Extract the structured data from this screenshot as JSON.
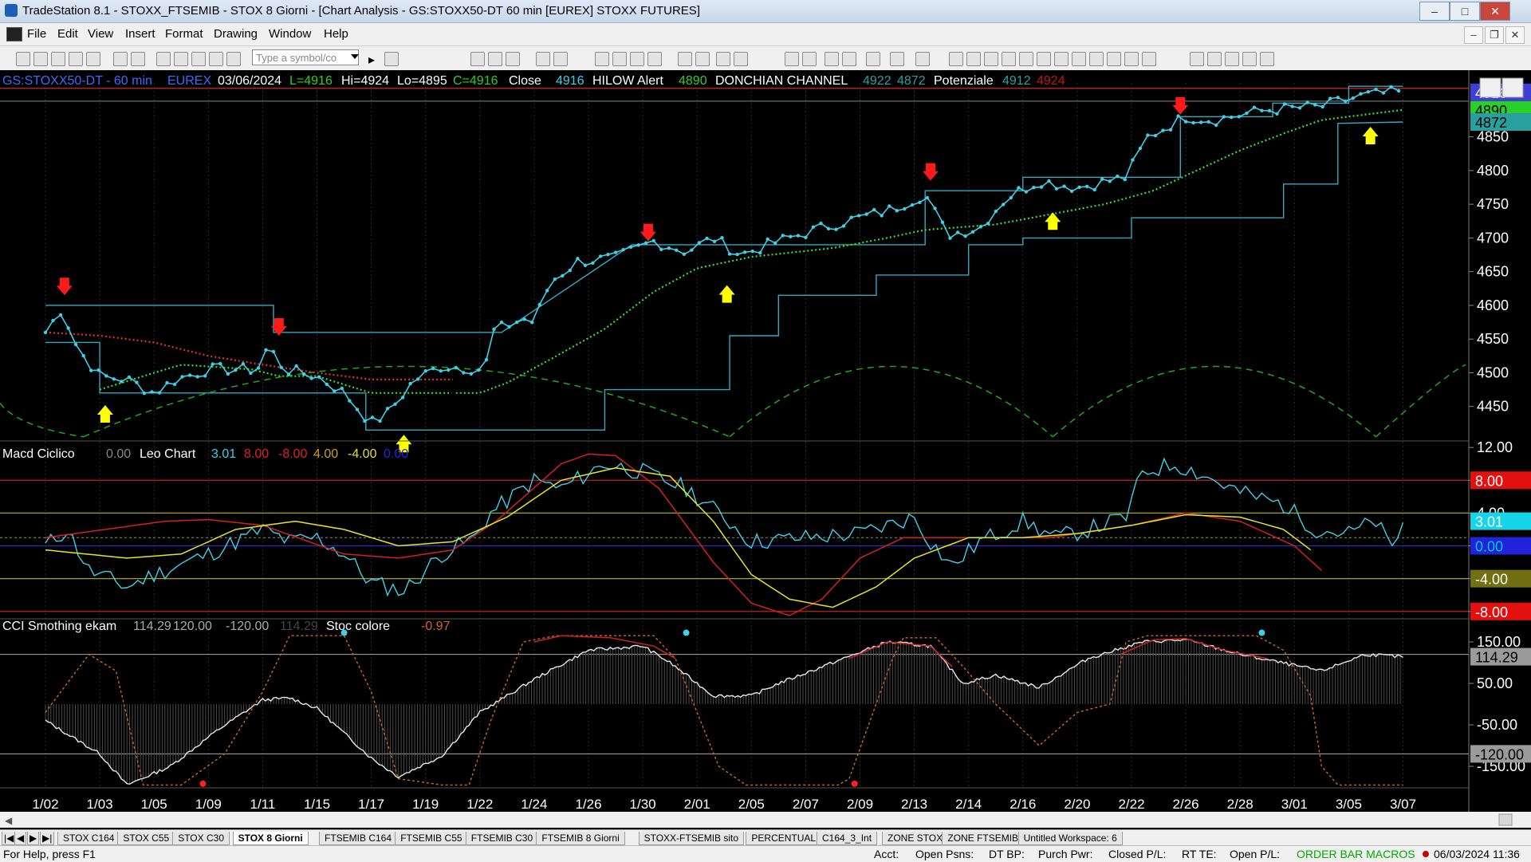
{
  "window": {
    "title": "TradeStation 8.1 - STOXX_FTSEMIB - STOX  8 Giorni - [Chart Analysis - GS:STOXX50-DT  60 min  [EUREX] STOXX FUTURES]"
  },
  "menu": [
    "File",
    "Edit",
    "View",
    "Insert",
    "Format",
    "Drawing",
    "Window",
    "Help"
  ],
  "toolbar": {
    "symbol_placeholder": "Type a symbol/co"
  },
  "colors": {
    "price": "#3fd0e8",
    "ma_up": "#31e031",
    "ma_down": "#e03030",
    "channel": "#34a8c0",
    "arrow_down": "#ff1a1a",
    "arrow_up": "#ffff00",
    "cycle": "#1fa51f"
  },
  "chart_data": [
    {
      "type": "line",
      "name": "price",
      "header": {
        "symbol": "GS:STOXX50-DT - 60 min",
        "exchange": "EUREX",
        "date": "03/06/2024",
        "last": "L=4916",
        "high": "Hi=4924",
        "low": "Lo=4895",
        "close": "C=4916",
        "close_label": "Close",
        "close_val": "4916",
        "hilow_label": "HILOW Alert",
        "hilow_val": "4890",
        "donchian_label": "DONCHIAN CHANNEL",
        "donchian_hi": "4922",
        "donchian_lo": "4872",
        "potenziale_label": "Potenziale",
        "potenziale_1": "4912",
        "potenziale_2": "4924"
      },
      "ylim": [
        4400,
        4930
      ],
      "yticks": [
        4450,
        4500,
        4550,
        4600,
        4650,
        4700,
        4750,
        4800,
        4850
      ],
      "last_price_labels": [
        "4916",
        "4890",
        "4872"
      ],
      "x_labels": [
        "1/02",
        "1/03",
        "1/05",
        "1/09",
        "1/11",
        "1/15",
        "1/17",
        "1/19",
        "1/22",
        "1/24",
        "1/26",
        "1/30",
        "2/01",
        "2/05",
        "2/07",
        "2/09",
        "2/13",
        "2/14",
        "2/16",
        "2/20",
        "2/22",
        "2/26",
        "2/28",
        "3/01",
        "3/05",
        "3/07"
      ],
      "close_anchors": [
        [
          0,
          4560
        ],
        [
          0.3,
          4595
        ],
        [
          0.6,
          4535
        ],
        [
          1.0,
          4495
        ],
        [
          1.5,
          4490
        ],
        [
          2.0,
          4470
        ],
        [
          2.4,
          4490
        ],
        [
          3.0,
          4505
        ],
        [
          3.9,
          4505
        ],
        [
          4.1,
          4540
        ],
        [
          4.4,
          4505
        ],
        [
          5.0,
          4495
        ],
        [
          5.5,
          4470
        ],
        [
          6.0,
          4425
        ],
        [
          6.3,
          4440
        ],
        [
          6.8,
          4490
        ],
        [
          7.3,
          4510
        ],
        [
          8.1,
          4505
        ],
        [
          8.2,
          4560
        ],
        [
          8.8,
          4580
        ],
        [
          9.0,
          4575
        ],
        [
          9.3,
          4635
        ],
        [
          9.8,
          4665
        ],
        [
          10.5,
          4670
        ],
        [
          11.2,
          4695
        ],
        [
          11.8,
          4680
        ],
        [
          12.3,
          4700
        ],
        [
          12.8,
          4675
        ],
        [
          13.5,
          4695
        ],
        [
          14.5,
          4720
        ],
        [
          15.5,
          4740
        ],
        [
          16.2,
          4765
        ],
        [
          16.6,
          4705
        ],
        [
          17.2,
          4715
        ],
        [
          17.7,
          4760
        ],
        [
          18.3,
          4785
        ],
        [
          19.0,
          4775
        ],
        [
          19.9,
          4790
        ],
        [
          20.3,
          4850
        ],
        [
          21.0,
          4880
        ],
        [
          21.5,
          4875
        ],
        [
          22.5,
          4890
        ],
        [
          23.5,
          4895
        ],
        [
          24.2,
          4910
        ],
        [
          24.7,
          4915
        ],
        [
          25.0,
          4916
        ]
      ],
      "ma_anchors": [
        [
          1.0,
          4475
        ],
        [
          1.8,
          4495
        ],
        [
          2.5,
          4512
        ],
        [
          3.8,
          4505
        ],
        [
          4.3,
          4495
        ],
        [
          5.0,
          4495
        ],
        [
          6.0,
          4470
        ],
        [
          7.0,
          4470
        ],
        [
          8.0,
          4470
        ],
        [
          8.5,
          4485
        ],
        [
          9.3,
          4520
        ],
        [
          10.3,
          4565
        ],
        [
          11.2,
          4620
        ],
        [
          12.0,
          4655
        ],
        [
          13.0,
          4672
        ],
        [
          14.5,
          4685
        ],
        [
          15.5,
          4700
        ],
        [
          16.2,
          4712
        ],
        [
          17.5,
          4720
        ],
        [
          18.5,
          4735
        ],
        [
          19.5,
          4750
        ],
        [
          20.4,
          4770
        ],
        [
          21.2,
          4800
        ],
        [
          22.0,
          4830
        ],
        [
          22.8,
          4855
        ],
        [
          23.5,
          4875
        ],
        [
          24.2,
          4882
        ],
        [
          25.0,
          4890
        ]
      ],
      "ma_split_day": 7.5,
      "dc_upper": [
        [
          0,
          4600
        ],
        [
          4.2,
          4600
        ],
        [
          4.2,
          4560
        ],
        [
          7.9,
          4560
        ],
        [
          7.9,
          4560
        ],
        [
          8.4,
          4560
        ],
        [
          10.8,
          4690
        ],
        [
          16.2,
          4690
        ],
        [
          16.2,
          4770
        ],
        [
          18.0,
          4770
        ],
        [
          18.0,
          4790
        ],
        [
          20.9,
          4790
        ],
        [
          20.9,
          4880
        ],
        [
          22.6,
          4880
        ],
        [
          22.6,
          4900
        ],
        [
          24.0,
          4900
        ],
        [
          24.0,
          4925
        ],
        [
          25.0,
          4925
        ]
      ],
      "dc_lower": [
        [
          0,
          4545
        ],
        [
          1.0,
          4545
        ],
        [
          1.0,
          4470
        ],
        [
          5.9,
          4470
        ],
        [
          5.9,
          4415
        ],
        [
          10.3,
          4415
        ],
        [
          10.3,
          4475
        ],
        [
          12.6,
          4475
        ],
        [
          12.6,
          4555
        ],
        [
          13.5,
          4555
        ],
        [
          13.5,
          4615
        ],
        [
          15.3,
          4615
        ],
        [
          15.3,
          4645
        ],
        [
          17.0,
          4645
        ],
        [
          17.0,
          4690
        ],
        [
          18.0,
          4690
        ],
        [
          18.0,
          4700
        ],
        [
          20.0,
          4700
        ],
        [
          20.0,
          4730
        ],
        [
          22.8,
          4730
        ],
        [
          22.8,
          4780
        ],
        [
          23.8,
          4780
        ],
        [
          23.8,
          4870
        ],
        [
          25.0,
          4872
        ]
      ],
      "down_arrows": [
        [
          0.35,
          4615
        ],
        [
          4.3,
          4555
        ],
        [
          11.1,
          4695
        ],
        [
          16.3,
          4785
        ],
        [
          20.9,
          4883
        ]
      ],
      "up_arrows": [
        [
          1.1,
          4452
        ],
        [
          6.6,
          4408
        ],
        [
          12.55,
          4630
        ],
        [
          18.55,
          4738
        ],
        [
          24.4,
          4865
        ]
      ],
      "cycle_lows_day": [
        0.7,
        12.6,
        18.55,
        24.5
      ],
      "cycle_top": 4515,
      "cycle_bottom": 4405
    },
    {
      "type": "line",
      "name": "macd",
      "header": {
        "title": "Macd Ciclico",
        "v0": "0.00",
        "title2": "Leo Chart",
        "v1": "3.01",
        "v2": "8.00",
        "v3": "-8.00",
        "v4": "4.00",
        "v5": "-4.00",
        "v6": "0.00"
      },
      "ylim": [
        -8.8,
        12.5
      ],
      "yticks": [
        -8,
        -4,
        0,
        4,
        8,
        12
      ],
      "tick_labels": [
        "-8.00",
        "-4.00",
        "0.00",
        "4.00",
        "8.00",
        "12.00"
      ],
      "last_labels": [
        "8.00",
        "3.01",
        "0.00",
        "-4.00",
        "-8.00"
      ],
      "osc_anchors": [
        [
          0,
          0
        ],
        [
          0.4,
          2
        ],
        [
          0.8,
          -3
        ],
        [
          1.5,
          -5
        ],
        [
          2.0,
          -3.5
        ],
        [
          3.0,
          -1
        ],
        [
          4.0,
          2
        ],
        [
          4.5,
          0.5
        ],
        [
          5.0,
          1.0
        ],
        [
          5.5,
          -1
        ],
        [
          6.0,
          -4.5
        ],
        [
          6.6,
          -5.5
        ],
        [
          7.3,
          -1
        ],
        [
          7.9,
          1
        ],
        [
          8.2,
          4
        ],
        [
          9.0,
          8
        ],
        [
          9.5,
          7
        ],
        [
          10.3,
          10
        ],
        [
          11.0,
          9
        ],
        [
          11.8,
          7
        ],
        [
          12.5,
          3.5
        ],
        [
          13.0,
          0.5
        ],
        [
          14.0,
          1.0
        ],
        [
          15.0,
          1.5
        ],
        [
          16.0,
          3.5
        ],
        [
          16.3,
          0.5
        ],
        [
          16.7,
          -2.5
        ],
        [
          17.2,
          0.5
        ],
        [
          18.0,
          3.0
        ],
        [
          18.6,
          1.0
        ],
        [
          19.2,
          2.0
        ],
        [
          19.9,
          3.5
        ],
        [
          20.2,
          9.0
        ],
        [
          20.8,
          10.0
        ],
        [
          21.2,
          9.0
        ],
        [
          22.0,
          6.5
        ],
        [
          22.8,
          5.0
        ],
        [
          23.4,
          2.0
        ],
        [
          24.0,
          1.5
        ],
        [
          24.5,
          3.0
        ],
        [
          24.8,
          -0.5
        ],
        [
          25.0,
          3.0
        ]
      ],
      "red_anchors": [
        [
          0,
          1.0
        ],
        [
          2.2,
          3.0
        ],
        [
          3.0,
          3.2
        ],
        [
          4.0,
          2.5
        ],
        [
          5.5,
          -1.0
        ],
        [
          6.5,
          -1.5
        ],
        [
          7.5,
          -0.5
        ],
        [
          8.3,
          3.0
        ],
        [
          9.5,
          10.0
        ],
        [
          10.0,
          11.2
        ],
        [
          10.5,
          11.0
        ],
        [
          11.3,
          7.0
        ],
        [
          12.3,
          -2.0
        ],
        [
          13.0,
          -7.0
        ],
        [
          13.7,
          -8.5
        ],
        [
          14.3,
          -6.5
        ],
        [
          15.0,
          -1.5
        ],
        [
          15.8,
          1.0
        ],
        [
          17.3,
          1.0
        ],
        [
          18.5,
          1.0
        ],
        [
          20.0,
          2.5
        ],
        [
          21.0,
          4.0
        ],
        [
          22.0,
          3.0
        ],
        [
          23.0,
          0.0
        ],
        [
          23.5,
          -3.0
        ]
      ],
      "yellow_anchors": [
        [
          0,
          -0.5
        ],
        [
          1.5,
          -1.5
        ],
        [
          2.5,
          -1.0
        ],
        [
          3.5,
          2.0
        ],
        [
          4.6,
          3.0
        ],
        [
          5.5,
          2.0
        ],
        [
          6.5,
          0.0
        ],
        [
          7.5,
          0.5
        ],
        [
          8.5,
          3.5
        ],
        [
          9.5,
          8.0
        ],
        [
          10.5,
          9.5
        ],
        [
          11.5,
          8.5
        ],
        [
          12.3,
          3.0
        ],
        [
          13.0,
          -3.5
        ],
        [
          13.7,
          -6.5
        ],
        [
          14.5,
          -7.5
        ],
        [
          15.3,
          -5.0
        ],
        [
          16.0,
          -1.5
        ],
        [
          17.0,
          1.0
        ],
        [
          18.0,
          1.0
        ],
        [
          19.0,
          1.5
        ],
        [
          20.0,
          2.5
        ],
        [
          21.0,
          3.8
        ],
        [
          22.0,
          3.5
        ],
        [
          22.8,
          2.0
        ],
        [
          23.3,
          -0.5
        ]
      ]
    },
    {
      "type": "line",
      "name": "cci",
      "header": {
        "title": "CCI Smothing ekam",
        "v0": "114.29",
        "v1": "120.00",
        "v2": "-120.00",
        "v3": "114.29",
        "title2": "Stoc colore",
        "v4": "-0.97"
      },
      "ylim": [
        -200,
        200
      ],
      "yticks": [
        -150,
        -50,
        50,
        150
      ],
      "tick_labels": [
        "-150.00",
        "-50.00",
        "50.00",
        "150.00"
      ],
      "last_labels": [
        "114.29",
        "-120.00"
      ],
      "cci_anchors": [
        [
          0,
          -40
        ],
        [
          1.0,
          -120
        ],
        [
          1.5,
          -195
        ],
        [
          2.3,
          -150
        ],
        [
          3.2,
          -60
        ],
        [
          4.0,
          10
        ],
        [
          4.5,
          15
        ],
        [
          5.0,
          -10
        ],
        [
          6.0,
          -130
        ],
        [
          6.5,
          -175
        ],
        [
          7.3,
          -125
        ],
        [
          8.0,
          -20
        ],
        [
          9.0,
          60
        ],
        [
          10.0,
          130
        ],
        [
          11.0,
          140
        ],
        [
          11.5,
          100
        ],
        [
          12.3,
          20
        ],
        [
          13.0,
          20
        ],
        [
          13.5,
          50
        ],
        [
          14.5,
          100
        ],
        [
          15.5,
          150
        ],
        [
          16.3,
          140
        ],
        [
          16.9,
          50
        ],
        [
          17.5,
          70
        ],
        [
          18.3,
          40
        ],
        [
          19.2,
          110
        ],
        [
          20.2,
          150
        ],
        [
          21.0,
          155
        ],
        [
          22.0,
          120
        ],
        [
          23.5,
          80
        ],
        [
          24.3,
          120
        ],
        [
          25.0,
          114
        ]
      ],
      "stoc_anchors": [
        [
          0,
          -20
        ],
        [
          0.8,
          120
        ],
        [
          1.3,
          80
        ],
        [
          1.8,
          -195
        ],
        [
          2.5,
          -195
        ],
        [
          3.3,
          -120
        ],
        [
          4.0,
          30
        ],
        [
          4.5,
          165
        ],
        [
          5.5,
          165
        ],
        [
          6.0,
          30
        ],
        [
          6.5,
          -180
        ],
        [
          7.3,
          -195
        ],
        [
          7.8,
          -195
        ],
        [
          8.2,
          -40
        ],
        [
          8.8,
          150
        ],
        [
          9.4,
          165
        ],
        [
          11.2,
          165
        ],
        [
          11.6,
          110
        ],
        [
          12.4,
          -150
        ],
        [
          12.9,
          -195
        ],
        [
          14.6,
          -195
        ],
        [
          14.8,
          -180
        ],
        [
          15.6,
          110
        ],
        [
          15.8,
          160
        ],
        [
          16.4,
          160
        ],
        [
          16.9,
          90
        ],
        [
          17.5,
          0
        ],
        [
          18.3,
          -100
        ],
        [
          19.0,
          -20
        ],
        [
          19.6,
          0
        ],
        [
          19.9,
          150
        ],
        [
          20.3,
          165
        ],
        [
          22.3,
          165
        ],
        [
          22.8,
          130
        ],
        [
          23.3,
          20
        ],
        [
          23.5,
          -150
        ],
        [
          23.8,
          -195
        ],
        [
          25.0,
          -195
        ]
      ],
      "markers_top": [
        5.5,
        11.8,
        22.4
      ],
      "markers_bottom": [
        2.9,
        14.9
      ]
    }
  ],
  "tabs": [
    "STOX C164",
    "STOX C55",
    "STOX  C30",
    "STOX  8 Giorni",
    "FTSEMIB C164",
    "FTSEMIB C55",
    "FTSEMIB C30",
    "FTSEMIB  8 Giorni",
    "STOXX-FTSEMIB sito",
    "PERCENTUALE",
    "C164_3_Int",
    "ZONE STOX",
    "ZONE FTSEMIB",
    "Untitled Workspace:  6"
  ],
  "active_tab": 3,
  "status": {
    "help": "For Help, press F1",
    "acct": "Acct:",
    "open_psns": "Open Psns:",
    "dt_bp": "DT BP:",
    "purch_pwr": "Purch Pwr:",
    "closed_pl": "Closed P/L:",
    "rt_te": "RT TE:",
    "open_pl": "Open P/L:",
    "order_bar": "ORDER BAR  MACROS",
    "datetime": "06/03/2024 11:36"
  }
}
